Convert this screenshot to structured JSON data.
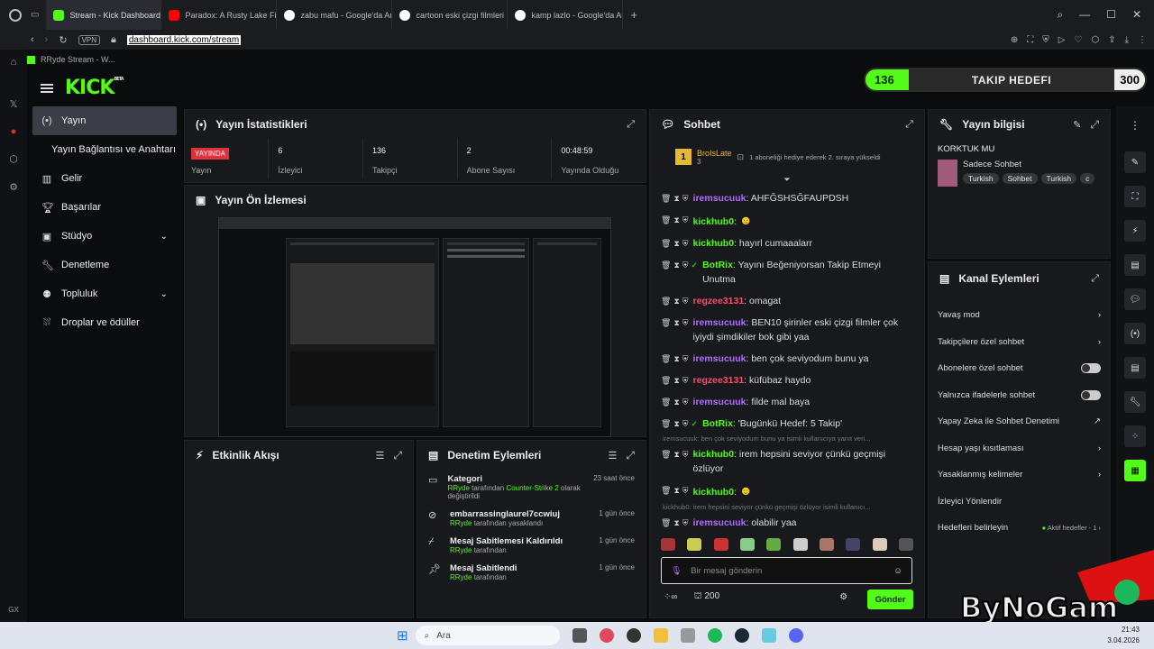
{
  "browser": {
    "tabs": [
      {
        "label": "Stream - Kick Dashboard",
        "color": "#53fc18"
      },
      {
        "label": "Paradox: A Rusty Lake Film",
        "color": "#ff0000"
      },
      {
        "label": "zabu mafu - Google'da Ara",
        "color": "#4285f4"
      },
      {
        "label": "cartoon eski çizgi filmleri -",
        "color": "#4285f4"
      },
      {
        "label": "kamp lazlo - Google'da Ara",
        "color": "#4285f4"
      }
    ],
    "vpn": "VPN",
    "url": "dashboard.kick.com/stream",
    "bookmark": "RRyde Stream - W..."
  },
  "header": {
    "logo": "KICK",
    "beta": "BETA"
  },
  "follow_goal": {
    "current": "136",
    "label": "TAKIP HEDEFI",
    "target": "300",
    "progress": 0.45
  },
  "sidebar": {
    "items": [
      {
        "label": "Yayın",
        "icon": "broadcast-icon"
      },
      {
        "label": "Yayın Bağlantısı ve Anahtarı",
        "icon": ""
      },
      {
        "label": "Gelir",
        "icon": "chart-icon"
      },
      {
        "label": "Başarılar",
        "icon": "trophy-icon"
      },
      {
        "label": "Stüdyo",
        "icon": "studio-icon"
      },
      {
        "label": "Denetleme",
        "icon": "wrench-icon"
      },
      {
        "label": "Topluluk",
        "icon": "community-icon"
      },
      {
        "label": "Droplar ve ödüller",
        "icon": "drops-icon"
      }
    ],
    "bottom_label": "GX"
  },
  "stats_panel": {
    "title": "Yayın İstatistikleri",
    "live_badge": "YAYINDA",
    "live_label": "Yayın",
    "stats": [
      {
        "value": "6",
        "label": "İzleyici"
      },
      {
        "value": "136",
        "label": "Takipçi"
      },
      {
        "value": "2",
        "label": "Abone Sayısı"
      },
      {
        "value": "00:48:59",
        "label": "Yayında Olduğu"
      }
    ]
  },
  "preview_panel": {
    "title": "Yayın Ön İzlemesi"
  },
  "activity_panel": {
    "title": "Etkinlik Akışı"
  },
  "mod_panel": {
    "title": "Denetim Eylemleri",
    "items": [
      {
        "title": "Kategori",
        "user": "RRyde",
        "pre": "tarafından",
        "game": "Counter-Strike 2",
        "post": "olarak değiştirildi",
        "time": "23 saat önce"
      },
      {
        "title": "embarrassinglaurel7ccwiuj",
        "user": "RRyde",
        "pre": "tarafından yasaklandı",
        "game": "",
        "post": "",
        "time": "1 gün önce"
      },
      {
        "title": "Mesaj Sabitlemesi Kaldırıldı",
        "user": "RRyde",
        "pre": "tarafından",
        "game": "",
        "post": "",
        "time": "1 gün önce"
      },
      {
        "title": "Mesaj Sabitlendi",
        "user": "RRyde",
        "pre": "tarafından",
        "game": "",
        "post": "",
        "time": "1 gün önce"
      }
    ]
  },
  "chat": {
    "title": "Sohbet",
    "gift": {
      "user": "BroIsLate",
      "rank": "1",
      "count": "3",
      "text": "1 aboneliği hediye ederek 2. sıraya yükseldi"
    },
    "messages": [
      {
        "user": "iremsucuuk",
        "color": "#b06cff",
        "text": "AHFĞSHSĞFAUPDSH"
      },
      {
        "user": "kickhub0",
        "color": "#53fc18",
        "text": "",
        "emote": true
      },
      {
        "user": "kickhub0",
        "color": "#53fc18",
        "text": "hayırl cumaaalarr"
      },
      {
        "user": "BotRix",
        "color": "#53fc18",
        "text": "Yayını Beğeniyorsan Takip Etmeyi Unutma",
        "bot": true
      },
      {
        "user": "regzee3131",
        "color": "#ff4d6a",
        "text": "omagat"
      },
      {
        "user": "iremsucuuk",
        "color": "#b06cff",
        "text": "BEN10 şirinler eski çizgi filmler çok iyiydi şimdikiler bok gibi yaa"
      },
      {
        "user": "iremsucuuk",
        "color": "#b06cff",
        "text": "ben çok seviyodum bunu ya"
      },
      {
        "user": "regzee3131",
        "color": "#ff4d6a",
        "text": "küfübaz haydo"
      },
      {
        "user": "iremsucuuk",
        "color": "#b06cff",
        "text": "filde mal baya"
      },
      {
        "user": "BotRix",
        "color": "#53fc18",
        "text": "'Bugünkü Hedef: 5 Takip'",
        "bot": true
      },
      {
        "reply": "iremsucuuk: ben çok seviyodum bunu ya isimli kullanıcıya yanıt veri...",
        "user": "kickhub0",
        "color": "#53fc18",
        "text": "irem hepsini seviyor çünkü geçmişi özlüyor"
      },
      {
        "user": "kickhub0",
        "color": "#53fc18",
        "text": "",
        "emote": true
      },
      {
        "reply": "kickhub0: irem hepsini seviyor çünkü geçmişi özlüyor isimli kullanıcı...",
        "user": "iremsucuuk",
        "color": "#b06cff",
        "text": "olabilir yaa"
      }
    ],
    "input_placeholder": "Bir mesaj gönderin",
    "points": "200",
    "send": "Gönder"
  },
  "info_panel": {
    "title": "Yayın bilgisi",
    "stream_title": "KORKTUK MU",
    "category": "Sadece Sohbet",
    "tags": [
      "Turkish",
      "Sohbet",
      "Turkish",
      "c"
    ]
  },
  "actions_panel": {
    "title": "Kanal Eylemleri",
    "rows": [
      {
        "label": "Yavaş mod",
        "kind": "chevron"
      },
      {
        "label": "Takipçilere özel sohbet",
        "kind": "chevron"
      },
      {
        "label": "Abonelere özel sohbet",
        "kind": "toggle"
      },
      {
        "label": "Yalnızca ifadelerle sohbet",
        "kind": "toggle"
      },
      {
        "label": "Yapay Zeka ile Sohbet Denetimi",
        "kind": "external"
      },
      {
        "label": "Hesap yaşı kısıtlaması",
        "kind": "chevron"
      },
      {
        "label": "Yasaklanmış kelimeler",
        "kind": "chevron"
      },
      {
        "label": "İzleyici Yönlendir",
        "kind": "none"
      },
      {
        "label": "Hedefleri belirleyin",
        "kind": "status",
        "status": "Aktif hedefler - 1"
      }
    ]
  },
  "taskbar": {
    "search": "Ara",
    "time": "21:43",
    "date": "3.04.2026"
  },
  "watermark": "ByNoGam"
}
